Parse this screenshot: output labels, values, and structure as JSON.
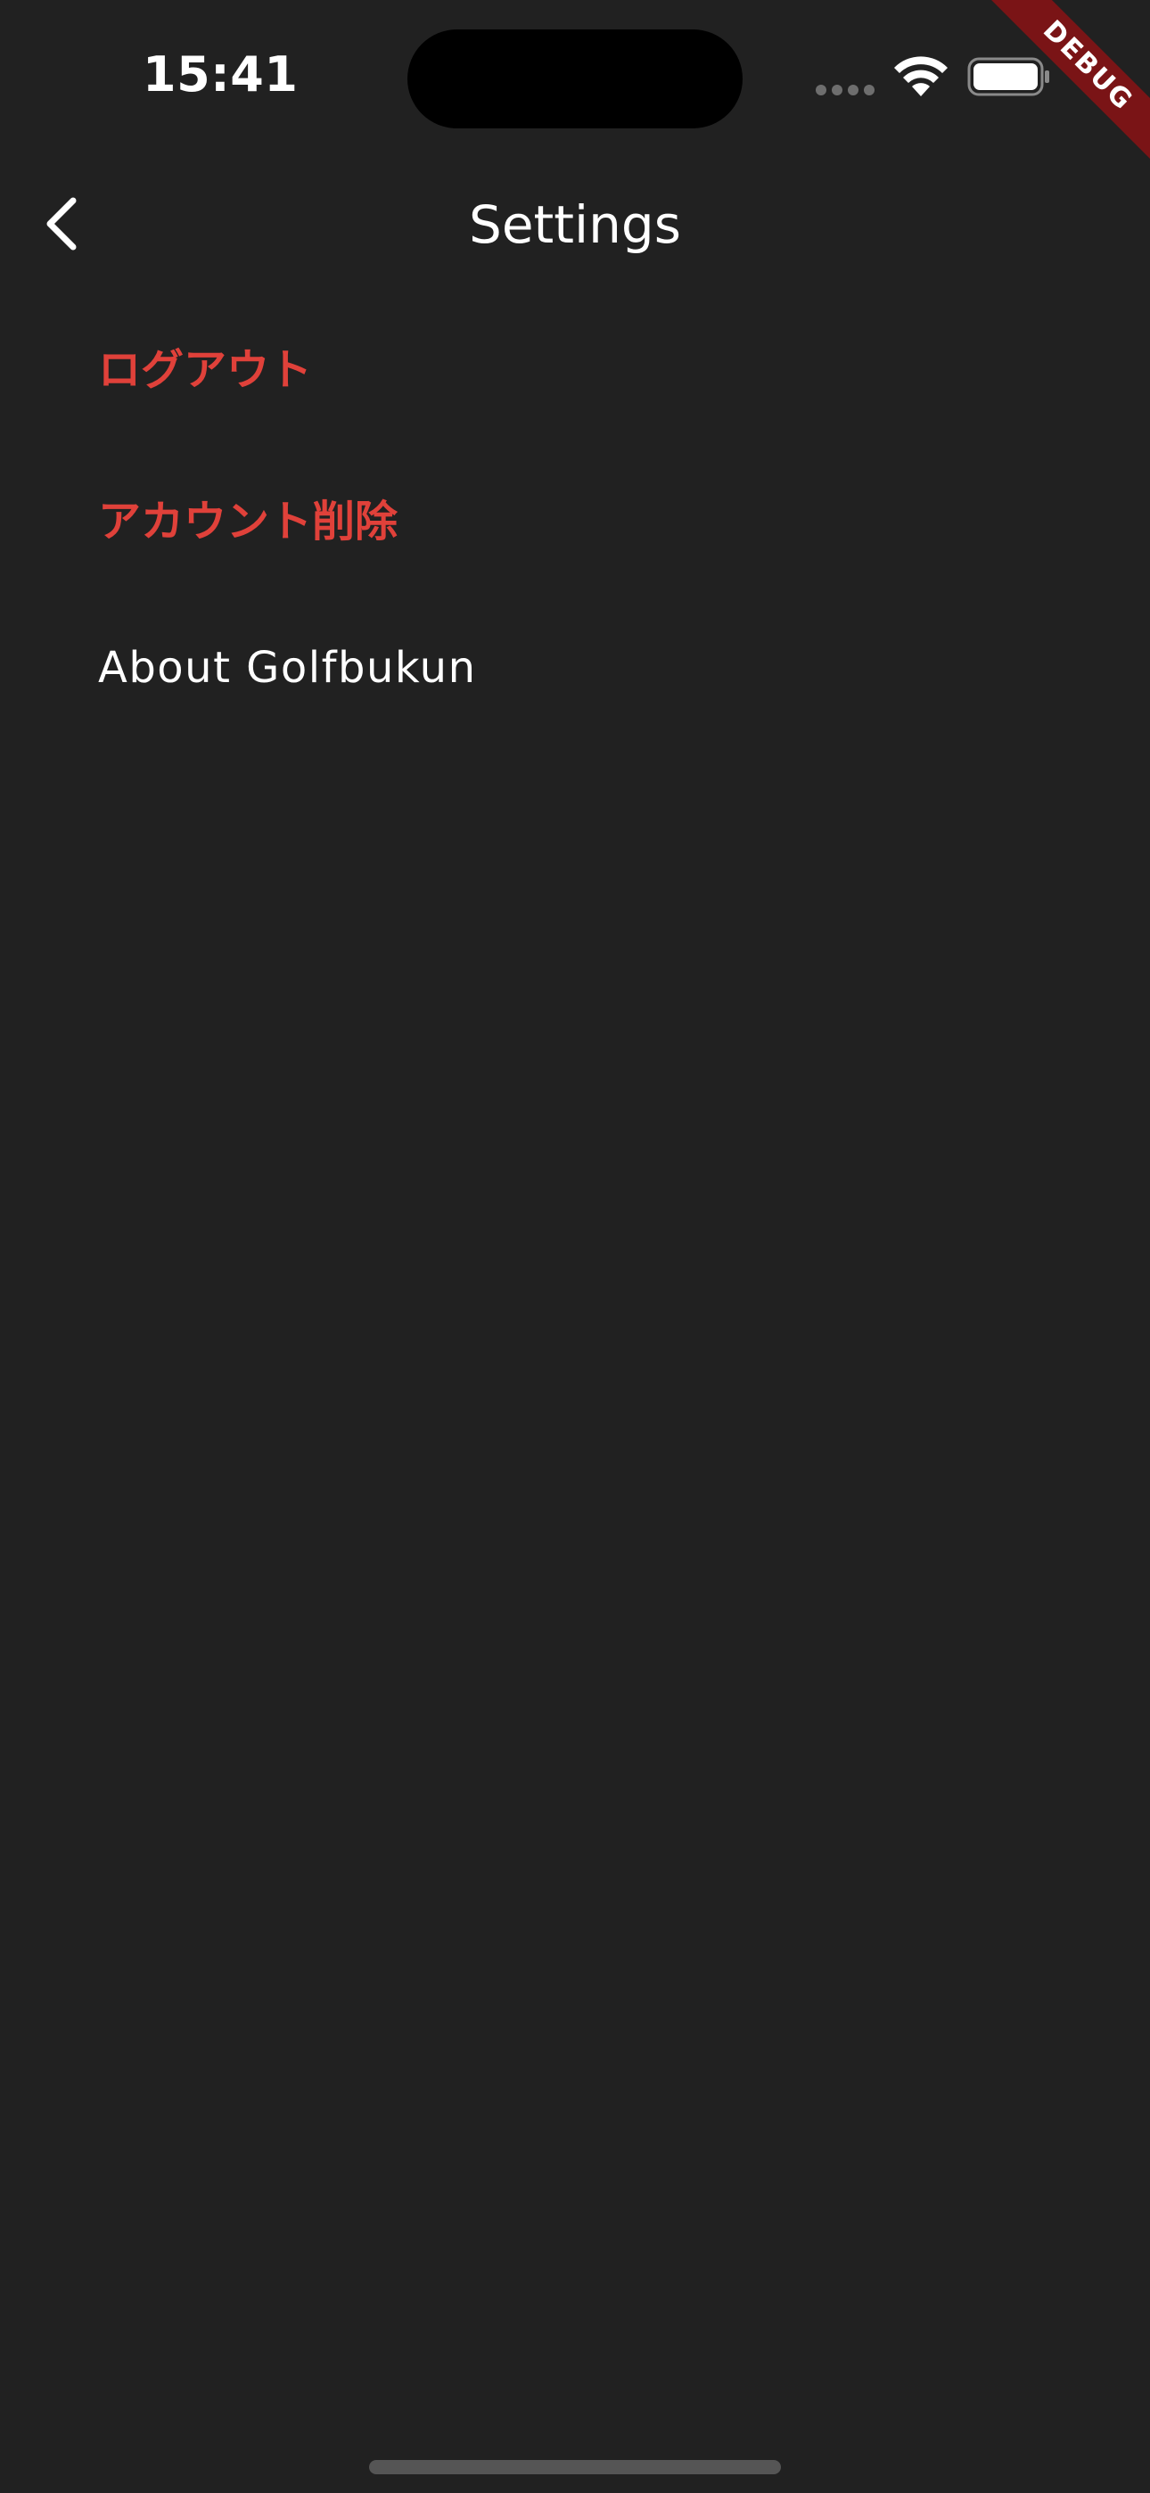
{
  "status_bar": {
    "time": "15:41"
  },
  "debug_banner": {
    "label": "DEBUG",
    "color": "#7a1416"
  },
  "app_bar": {
    "title": "Settings",
    "back_icon": "chevron-left-icon"
  },
  "menu": {
    "items": [
      {
        "label": "ログアウト",
        "style": "danger"
      },
      {
        "label": "アカウント削除",
        "style": "danger"
      },
      {
        "label": "About Golfbukun",
        "style": "normal"
      }
    ]
  },
  "colors": {
    "background": "#212121",
    "danger_text": "#e0413a",
    "text": "#ffffff"
  }
}
